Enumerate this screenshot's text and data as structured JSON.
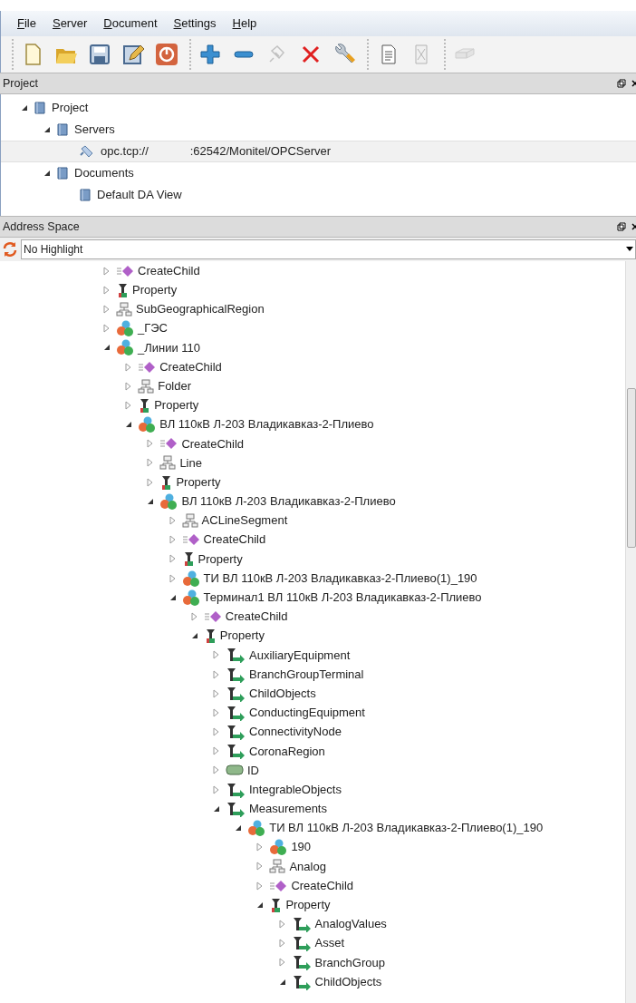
{
  "menu": [
    {
      "label": "File"
    },
    {
      "label": "Server"
    },
    {
      "label": "Document"
    },
    {
      "label": "Settings"
    },
    {
      "label": "Help"
    }
  ],
  "toolbar": [
    [
      {
        "kind": "new",
        "disabled": false
      },
      {
        "kind": "open",
        "disabled": false
      },
      {
        "kind": "save",
        "disabled": false
      },
      {
        "kind": "edit",
        "disabled": false
      },
      {
        "kind": "power",
        "disabled": false
      }
    ],
    [
      {
        "kind": "add",
        "disabled": false
      },
      {
        "kind": "remove",
        "disabled": false
      },
      {
        "kind": "connect",
        "disabled": true
      },
      {
        "kind": "delete",
        "disabled": false
      },
      {
        "kind": "wrench",
        "disabled": false
      }
    ],
    [
      {
        "kind": "page",
        "disabled": false
      },
      {
        "kind": "page-x",
        "disabled": true
      }
    ],
    [
      {
        "kind": "device",
        "disabled": true
      }
    ]
  ],
  "project_panel": {
    "title": "Project",
    "tree": [
      {
        "label": "Project",
        "kind": "book",
        "expanded": true,
        "selected": false,
        "children": [
          {
            "label": "Servers",
            "kind": "book",
            "expanded": true,
            "selected": false,
            "children": [
              {
                "label": "opc.tcp://",
                "label_2": ":62542/Monitel/OPCServer",
                "kind": "server",
                "selected": true
              }
            ]
          },
          {
            "label": "Documents",
            "kind": "book",
            "expanded": true,
            "selected": false,
            "children": [
              {
                "label": "Default DA View",
                "kind": "book",
                "selected": false
              }
            ]
          }
        ]
      }
    ]
  },
  "address_panel": {
    "title": "Address Space",
    "highlight": {
      "value": "No Highlight"
    },
    "tree": [
      {
        "label": "CreateChild",
        "kind": "method",
        "expanded": false
      },
      {
        "label": "Property",
        "kind": "property",
        "expanded": false
      },
      {
        "label": "SubGeographicalRegion",
        "kind": "folder",
        "expanded": false
      },
      {
        "label": "_ГЭС",
        "kind": "object",
        "expanded": false
      },
      {
        "label": "_Линии 110",
        "kind": "object",
        "expanded": true,
        "children": [
          {
            "label": "CreateChild",
            "kind": "method",
            "expanded": false
          },
          {
            "label": "Folder",
            "kind": "folder",
            "expanded": false
          },
          {
            "label": "Property",
            "kind": "property",
            "expanded": false
          },
          {
            "label": "ВЛ 110кВ Л-203 Владикавказ-2-Плиево",
            "kind": "object",
            "expanded": true,
            "children": [
              {
                "label": "CreateChild",
                "kind": "method",
                "expanded": false
              },
              {
                "label": "Line",
                "kind": "folder",
                "expanded": false
              },
              {
                "label": "Property",
                "kind": "property",
                "expanded": false
              },
              {
                "label": "ВЛ 110кВ Л-203 Владикавказ-2-Плиево",
                "kind": "object",
                "expanded": true,
                "children": [
                  {
                    "label": "ACLineSegment",
                    "kind": "folder",
                    "expanded": false
                  },
                  {
                    "label": "CreateChild",
                    "kind": "method",
                    "expanded": false
                  },
                  {
                    "label": "Property",
                    "kind": "property",
                    "expanded": false
                  },
                  {
                    "label": "ТИ ВЛ 110кВ Л-203 Владикавказ-2-Плиево(1)_190",
                    "kind": "object",
                    "expanded": false
                  },
                  {
                    "label": "Терминал1 ВЛ 110кВ Л-203 Владикавказ-2-Плиево",
                    "kind": "object",
                    "expanded": true,
                    "children": [
                      {
                        "label": "CreateChild",
                        "kind": "method",
                        "expanded": false
                      },
                      {
                        "label": "Property",
                        "kind": "property",
                        "expanded": true,
                        "children": [
                          {
                            "label": "AuxiliaryEquipment",
                            "kind": "reference",
                            "expanded": false
                          },
                          {
                            "label": "BranchGroupTerminal",
                            "kind": "reference",
                            "expanded": false
                          },
                          {
                            "label": "ChildObjects",
                            "kind": "reference",
                            "expanded": false
                          },
                          {
                            "label": "ConductingEquipment",
                            "kind": "reference",
                            "expanded": false
                          },
                          {
                            "label": "ConnectivityNode",
                            "kind": "reference",
                            "expanded": false
                          },
                          {
                            "label": "CoronaRegion",
                            "kind": "reference",
                            "expanded": false
                          },
                          {
                            "label": "ID",
                            "kind": "variable",
                            "expanded": false
                          },
                          {
                            "label": "IntegrableObjects",
                            "kind": "reference",
                            "expanded": false
                          },
                          {
                            "label": "Measurements",
                            "kind": "reference",
                            "expanded": true,
                            "children": [
                              {
                                "label": "ТИ ВЛ 110кВ Л-203 Владикавказ-2-Плиево(1)_190",
                                "kind": "object",
                                "expanded": true,
                                "children": [
                                  {
                                    "label": "190",
                                    "kind": "object",
                                    "expanded": false
                                  },
                                  {
                                    "label": "Analog",
                                    "kind": "folder",
                                    "expanded": false
                                  },
                                  {
                                    "label": "CreateChild",
                                    "kind": "method",
                                    "expanded": false
                                  },
                                  {
                                    "label": "Property",
                                    "kind": "property",
                                    "expanded": true,
                                    "children": [
                                      {
                                        "label": "AnalogValues",
                                        "kind": "reference",
                                        "expanded": false
                                      },
                                      {
                                        "label": "Asset",
                                        "kind": "reference",
                                        "expanded": false
                                      },
                                      {
                                        "label": "BranchGroup",
                                        "kind": "reference",
                                        "expanded": false
                                      },
                                      {
                                        "label": "ChildObjects",
                                        "kind": "reference",
                                        "expanded": true
                                      }
                                    ]
                                  }
                                ]
                              }
                            ]
                          }
                        ]
                      }
                    ]
                  }
                ]
              }
            ]
          }
        ]
      }
    ]
  }
}
